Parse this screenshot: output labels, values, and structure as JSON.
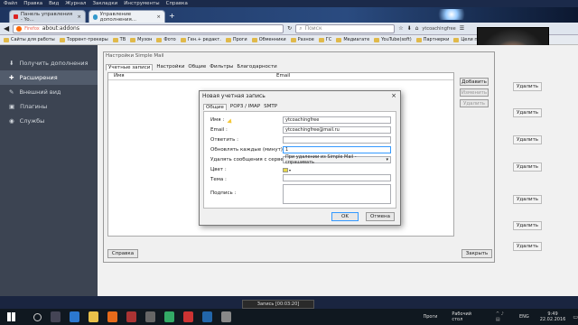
{
  "menu": [
    "Файл",
    "Правка",
    "Вид",
    "Журнал",
    "Закладки",
    "Инструменты",
    "Справка"
  ],
  "tabs": [
    {
      "label": "Панель управления - Yo..."
    },
    {
      "label": "Управление дополнения..."
    }
  ],
  "browser_label": "Firefox",
  "url": "about:addons",
  "search_placeholder": "Поиск",
  "profile_name": "ytcoachingfree",
  "bookmarks": [
    "Сайты для работы",
    "Торрент-трекеры",
    "TB",
    "Музон",
    "Фото",
    "Ген.+ редакт.",
    "Проги",
    "Обменники",
    "Разное",
    "ГС",
    "Медиагате",
    "YouTube(soft)",
    "Партнерки",
    "Цели продвиж."
  ],
  "sidebar": [
    {
      "label": "Получить дополнения"
    },
    {
      "label": "Расширения"
    },
    {
      "label": "Внешний вид"
    },
    {
      "label": "Плагины"
    },
    {
      "label": "Службы"
    }
  ],
  "remove_label": "Удалить",
  "settings": {
    "title": "Настройки Simple Mail",
    "tabs": [
      "Учетные записи",
      "Настройки",
      "Общие",
      "Фильтры",
      "Благодарности"
    ],
    "col_name": "Имя",
    "col_email": "Email",
    "add": "Добавить",
    "edit": "Изменить",
    "delete": "Удалить",
    "help": "Справка",
    "close": "Закрыть"
  },
  "dialog": {
    "title": "Новая учетная запись",
    "tabs": [
      "Общие",
      "POP3 / IMAP",
      "SMTP"
    ],
    "name_label": "Имя :",
    "name_value": "ytcoachingfree",
    "email_label": "Email :",
    "email_value": "ytcoachingfree@mail.ru",
    "reply_label": "Ответить :",
    "interval_label": "Обновлять каждые (минут) :",
    "interval_value": "1",
    "delete_label": "Удалять сообщения с сервера :",
    "delete_value": "При удалении из Simple Mail - спрашивать",
    "color_label": "Цвет :",
    "subject_label": "Тема :",
    "signature_label": "Подпись :",
    "ok": "OK",
    "cancel": "Отмена"
  },
  "taskbar": {
    "recording": "Запись [00:03:20]",
    "apps": "Проги",
    "desktop": "Рабочий стол",
    "lang": "ENG",
    "time": "9:49",
    "date": "22.02.2016"
  }
}
